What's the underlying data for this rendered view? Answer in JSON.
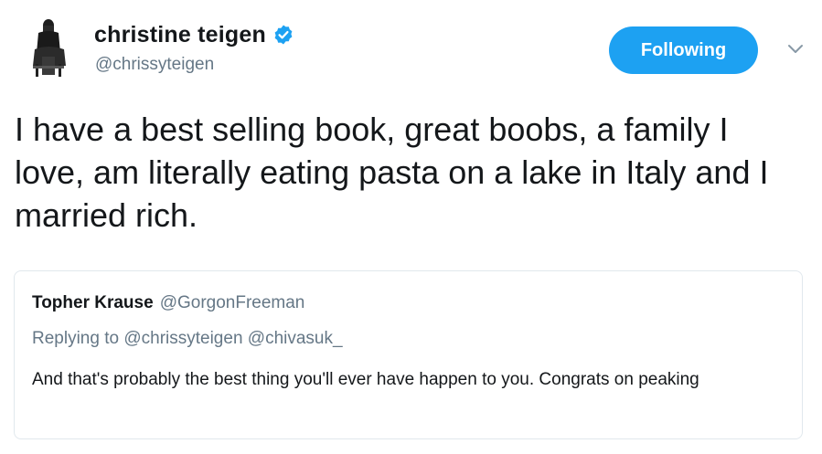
{
  "author": {
    "display_name": "christine teigen",
    "handle": "@chrissyteigen",
    "verified": true,
    "avatar_icon": "profile-photo-avatar"
  },
  "actions": {
    "follow_label": "Following",
    "caret_icon": "chevron-down-icon"
  },
  "tweet": {
    "text": "I have a best selling book, great boobs, a family I love, am literally eating pasta on a lake in Italy and I married rich."
  },
  "quoted_tweet": {
    "author_name": "Topher Krause",
    "author_handle": "@GorgonFreeman",
    "replying_to": "Replying to @chrissyteigen @chivasuk_",
    "text": "And that's probably the best thing you'll ever have happen to you. Congrats on peaking"
  },
  "colors": {
    "accent": "#1da1f2",
    "secondary_text": "#657786",
    "primary_text": "#14171a",
    "border": "#e1e8ed"
  }
}
